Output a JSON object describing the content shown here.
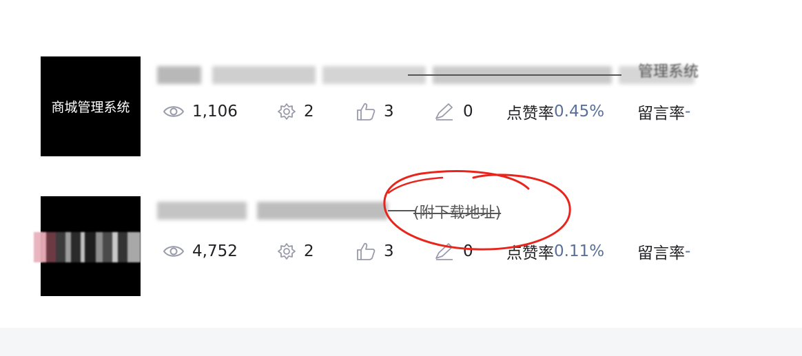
{
  "articles": [
    {
      "thumbnail_text": "商城管理系统",
      "title_visible_fragment": "管理系统",
      "stats": {
        "views": "1,106",
        "favorites": "2",
        "likes": "3",
        "comments": "0",
        "like_rate_label": "点赞率",
        "like_rate_value": "0.45%",
        "message_rate_label": "留言率",
        "message_rate_value": "-"
      }
    },
    {
      "thumbnail_text": "",
      "title_visible_fragment": "(附下载地址)",
      "stats": {
        "views": "4,752",
        "favorites": "2",
        "likes": "3",
        "comments": "0",
        "like_rate_label": "点赞率",
        "like_rate_value": "0.11%",
        "message_rate_label": "留言率",
        "message_rate_value": "-"
      }
    }
  ],
  "icons": [
    "eye-icon",
    "star-icon",
    "thumb-up-icon",
    "pencil-icon"
  ],
  "colors": {
    "accent": "#5a6f99",
    "annotation": "#e8251c",
    "footer": "#f5f6f7"
  }
}
